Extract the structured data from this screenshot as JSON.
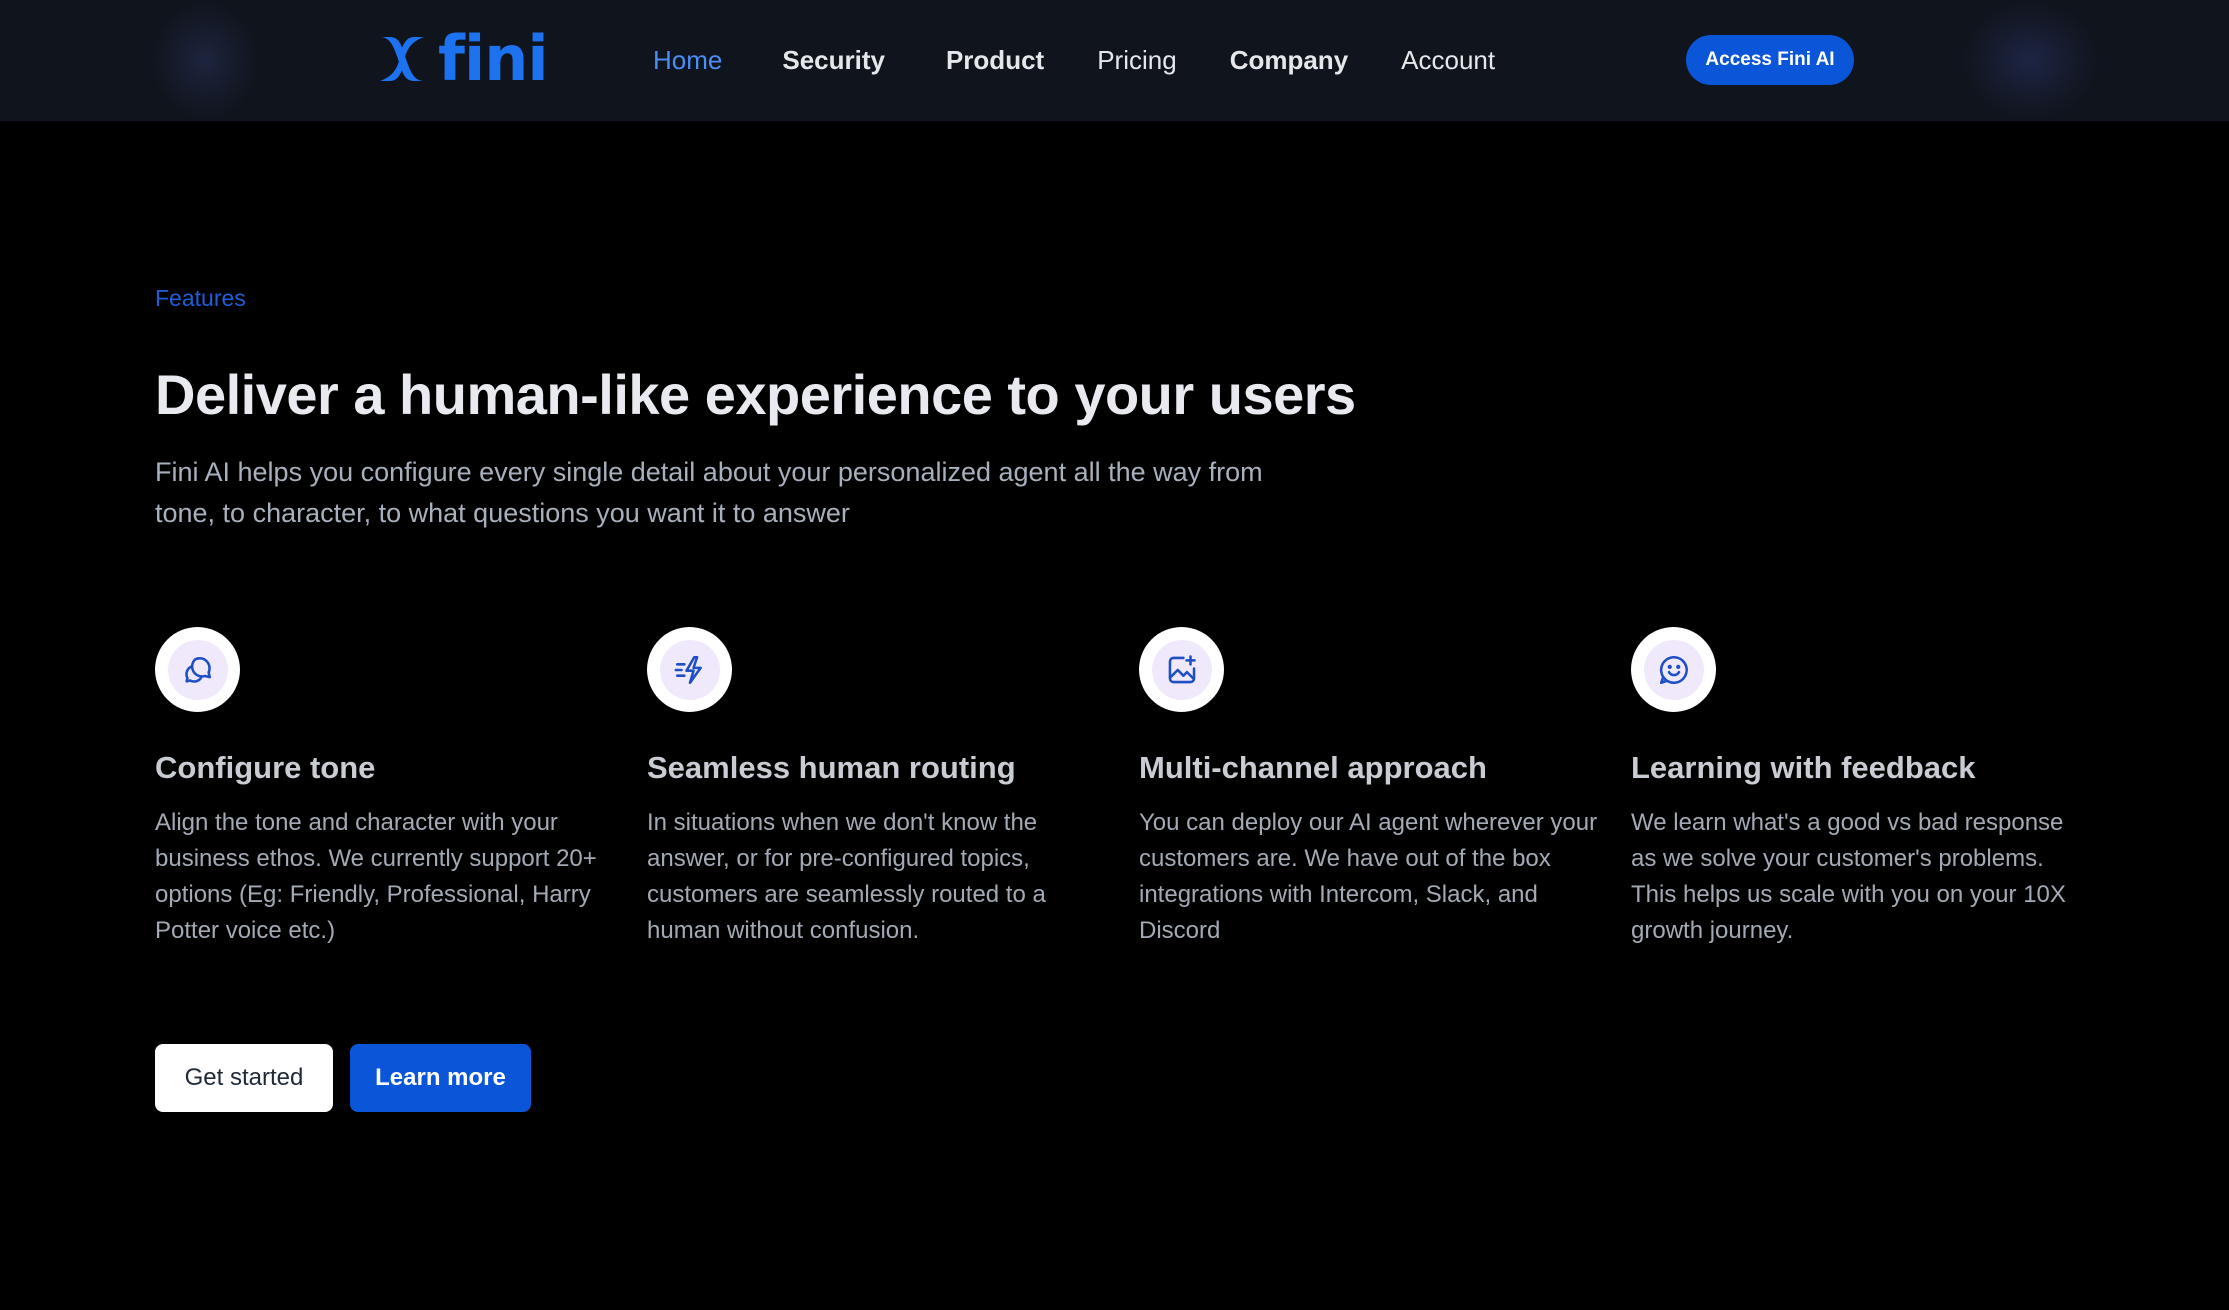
{
  "nav": {
    "logo_text": "fini",
    "links": [
      {
        "label": "Home",
        "active": true,
        "bold": false
      },
      {
        "label": "Security",
        "active": false,
        "bold": true
      },
      {
        "label": "Product",
        "active": false,
        "bold": true
      },
      {
        "label": "Pricing",
        "active": false,
        "bold": false
      },
      {
        "label": "Company",
        "active": false,
        "bold": true
      },
      {
        "label": "Account",
        "active": false,
        "bold": false
      }
    ],
    "cta_label": "Access Fini AI"
  },
  "hero": {
    "eyebrow": "Features",
    "headline": "Deliver a human-like experience to your users",
    "subhead": "Fini AI helps you configure every single detail about your personalized agent all the way from tone, to character, to what questions you want it to answer"
  },
  "features": [
    {
      "icon": "chat-bubbles-icon",
      "title": "Configure tone",
      "description": "Align the tone and character with your business ethos. We currently support 20+ options (Eg: Friendly, Professional, Harry Potter voice etc.)"
    },
    {
      "icon": "lightning-routing-icon",
      "title": "Seamless human routing",
      "description": "In situations when we don't know the answer, or for pre-configured topics, customers are seamlessly routed to a human without confusion."
    },
    {
      "icon": "image-sparkle-icon",
      "title": "Multi-channel approach",
      "description": "You can deploy our AI agent wherever your customers are. We have out of the box integrations with Intercom, Slack, and Discord"
    },
    {
      "icon": "smiley-chat-icon",
      "title": "Learning with feedback",
      "description": "We learn what's a good vs bad response as we solve your customer's problems. This helps us scale with you on your 10X growth journey."
    }
  ],
  "buttons": {
    "get_started": "Get started",
    "learn_more": "Learn more"
  },
  "colors": {
    "accent": "#0b56d8",
    "logo_blue": "#1d72f0",
    "nav_active": "#4a8df5",
    "icon_stroke": "#1e4fc4"
  }
}
